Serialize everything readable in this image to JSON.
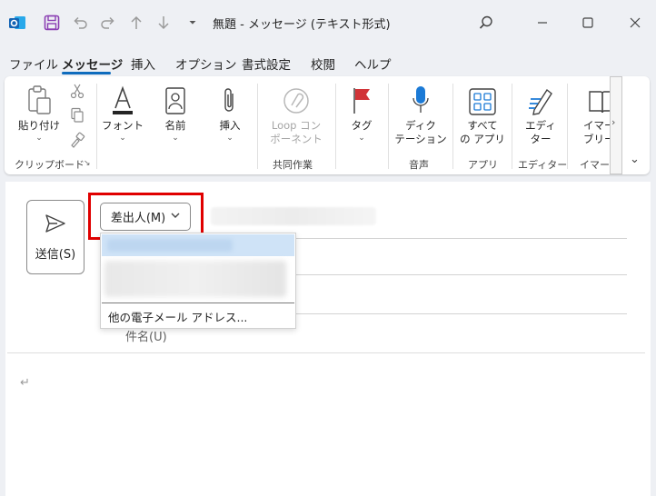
{
  "titlebar": {
    "title": "無題 - メッセージ (テキスト形式)",
    "qat_more_glyph": "⏷"
  },
  "menu": {
    "tabs": [
      "ファイル",
      "メッセージ",
      "挿入",
      "オプション",
      "書式設定",
      "校閲",
      "ヘルプ"
    ],
    "active": "メッセージ"
  },
  "ribbon": {
    "paste_label": "貼り付け",
    "clipboard_group": "クリップボード",
    "font_label": "フォント",
    "names_label": "名前",
    "attach_label": "挿入",
    "loop_label": "Loop コン\nポーネント",
    "collab_group": "共同作業",
    "tag_label": "タグ",
    "dictate_label": "ディク\nテーション",
    "voice_group": "音声",
    "apps_label": "すべて\nの アプリ",
    "apps_group": "アプリ",
    "editor_label": "エディ\nター",
    "editor_group": "エディター",
    "immersive_label": "イマー\nブリー",
    "immersive_group": "イマー",
    "chevron": "⌄"
  },
  "compose": {
    "send_label": "送信(S)",
    "from_label": "差出人(M)",
    "dropdown_other": "他の電子メール アドレス...",
    "subject_label": "件名(U)",
    "return_glyph": "↵"
  },
  "colors": {
    "accent": "#0f6cbd",
    "highlight": "#e00000",
    "outlook_blue": "#1364b4",
    "save_purple": "#8b3fb3",
    "flag_red": "#d13438",
    "mic_blue": "#1b7ad6"
  },
  "icons": [
    "outlook-icon",
    "save-icon",
    "undo-icon",
    "redo-icon",
    "up-arrow-icon",
    "down-arrow-icon",
    "search-icon",
    "minimize-icon",
    "maximize-icon",
    "close-icon",
    "paste-icon",
    "cut-icon",
    "copy-icon",
    "format-painter-icon",
    "font-icon",
    "address-book-icon",
    "paperclip-icon",
    "loop-icon",
    "flag-icon",
    "microphone-icon",
    "apps-grid-icon",
    "editor-pen-icon",
    "immersive-reader-icon",
    "send-icon"
  ]
}
